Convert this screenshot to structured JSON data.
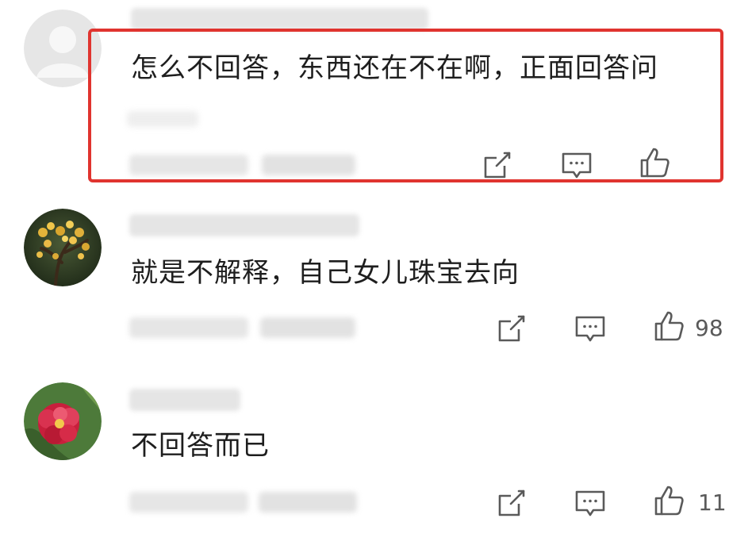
{
  "comments": [
    {
      "text": "怎么不回答，东西还在不在啊，正面回答问",
      "like_count": "",
      "avatar": "default-avatar"
    },
    {
      "text": "就是不解释，自己女儿珠宝去向",
      "like_count": "98",
      "avatar": "flower-tree-avatar"
    },
    {
      "text": "不回答而已",
      "like_count": "11",
      "avatar": "red-flower-avatar"
    }
  ],
  "icons": {
    "share": "share-icon",
    "reply": "comment-icon",
    "like": "thumbs-up-icon"
  },
  "colors": {
    "highlight_border": "#e0342f",
    "text": "#1e1e1e",
    "icon": "#5a5a5a"
  }
}
